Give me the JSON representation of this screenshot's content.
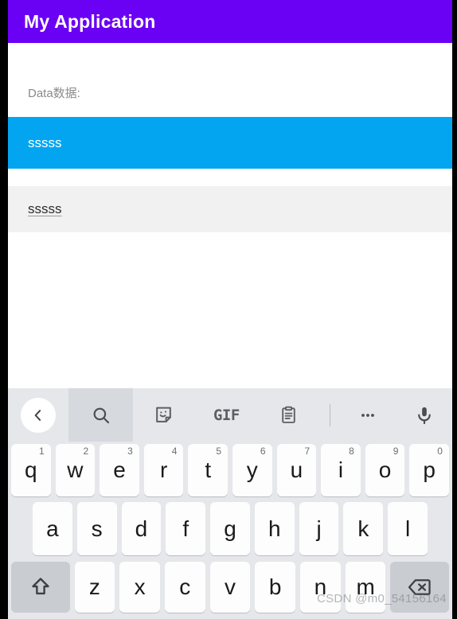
{
  "appbar": {
    "title": "My Application",
    "background": "#6a00f4",
    "text_color": "#ffffff"
  },
  "content": {
    "field_label": "Data数据:",
    "rows": [
      {
        "text": "sssss",
        "state": "selected",
        "background": "#03a5f0",
        "text_color": "#ffffff"
      },
      {
        "text": "sssss",
        "state": "normal",
        "background": "#f1f1f1",
        "text_color": "#2b2b2b"
      }
    ]
  },
  "keyboard": {
    "toolbar": [
      {
        "name": "back-chevron-icon",
        "label": "‹"
      },
      {
        "name": "search-icon",
        "label": "search",
        "selected": true
      },
      {
        "name": "sticker-icon",
        "label": "sticker"
      },
      {
        "name": "gif-icon",
        "label": "GIF"
      },
      {
        "name": "clipboard-icon",
        "label": "clipboard"
      },
      {
        "name": "more-icon",
        "label": "•••"
      },
      {
        "name": "microphone-icon",
        "label": "mic"
      }
    ],
    "row1": [
      {
        "letter": "q",
        "number": "1"
      },
      {
        "letter": "w",
        "number": "2"
      },
      {
        "letter": "e",
        "number": "3"
      },
      {
        "letter": "r",
        "number": "4"
      },
      {
        "letter": "t",
        "number": "5"
      },
      {
        "letter": "y",
        "number": "6"
      },
      {
        "letter": "u",
        "number": "7"
      },
      {
        "letter": "i",
        "number": "8"
      },
      {
        "letter": "o",
        "number": "9"
      },
      {
        "letter": "p",
        "number": "0"
      }
    ],
    "row2": [
      {
        "letter": "a"
      },
      {
        "letter": "s"
      },
      {
        "letter": "d"
      },
      {
        "letter": "f"
      },
      {
        "letter": "g"
      },
      {
        "letter": "h"
      },
      {
        "letter": "j"
      },
      {
        "letter": "k"
      },
      {
        "letter": "l"
      }
    ],
    "row3": [
      {
        "letter": "z"
      },
      {
        "letter": "x"
      },
      {
        "letter": "c"
      },
      {
        "letter": "v"
      },
      {
        "letter": "b"
      },
      {
        "letter": "n"
      },
      {
        "letter": "m"
      }
    ],
    "shift_key": "shift",
    "backspace_key": "backspace",
    "background": "#e5e7ea",
    "key_background": "#fdfdfd",
    "fn_key_background": "#c9ccd1"
  },
  "watermark": {
    "text": "CSDN @m0_54156164"
  }
}
